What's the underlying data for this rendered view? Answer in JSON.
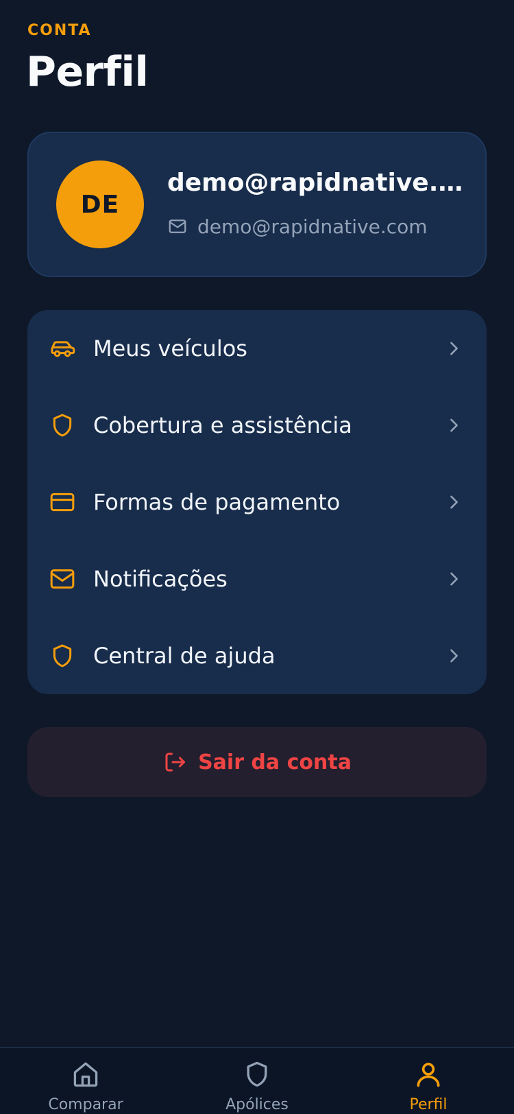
{
  "header": {
    "section_label": "CONTA",
    "title": "Perfil"
  },
  "profile": {
    "initials": "DE",
    "name": "demo@rapidnative.co...",
    "email": "demo@rapidnative.com",
    "avatar_color": "#f59e0b"
  },
  "menu": {
    "items": [
      {
        "icon": "car-icon",
        "label": "Meus veículos"
      },
      {
        "icon": "shield-icon",
        "label": "Cobertura e assistência"
      },
      {
        "icon": "credit-card-icon",
        "label": "Formas de pagamento"
      },
      {
        "icon": "mail-icon",
        "label": "Notificações"
      },
      {
        "icon": "shield-icon",
        "label": "Central de ajuda"
      }
    ]
  },
  "logout": {
    "label": "Sair da conta",
    "icon": "logout-icon",
    "color": "#ef4444"
  },
  "tabbar": {
    "tabs": [
      {
        "icon": "home-icon",
        "label": "Comparar",
        "active": false
      },
      {
        "icon": "shield-icon",
        "label": "Apólices",
        "active": false
      },
      {
        "icon": "user-icon",
        "label": "Perfil",
        "active": true
      }
    ]
  },
  "colors": {
    "accent": "#f59e0b",
    "background": "#0e1829",
    "card": "#182c4b",
    "danger": "#ef4444",
    "muted": "#94a3b8"
  }
}
